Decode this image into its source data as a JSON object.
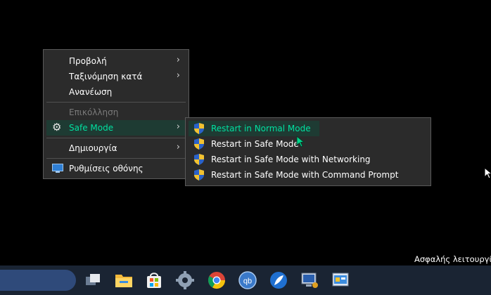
{
  "context_menu": {
    "items": [
      {
        "label": "Προβολή"
      },
      {
        "label": "Ταξινόμηση κατά"
      },
      {
        "label": "Ανανέωση"
      },
      {
        "label": "Επικόλληση"
      },
      {
        "label": "Safe Mode"
      },
      {
        "label": "Δημιουργία"
      },
      {
        "label": "Ρυθμίσεις οθόνης"
      }
    ]
  },
  "submenu": {
    "items": [
      {
        "label": "Restart in Normal Mode"
      },
      {
        "label": "Restart in Safe Mode"
      },
      {
        "label": "Restart in Safe Mode with Networking"
      },
      {
        "label": "Restart in Safe Mode with Command Prompt"
      }
    ]
  },
  "desktop": {
    "status_text": "Ασφαλής λειτουργία"
  },
  "icons": {
    "gear": "gear-icon",
    "monitor": "display-settings-icon",
    "shield": "uac-shield-icon"
  },
  "colors": {
    "accent_text": "#00e0a0",
    "highlight": "#1e3b33",
    "menu_bg": "#2b2b2b"
  }
}
